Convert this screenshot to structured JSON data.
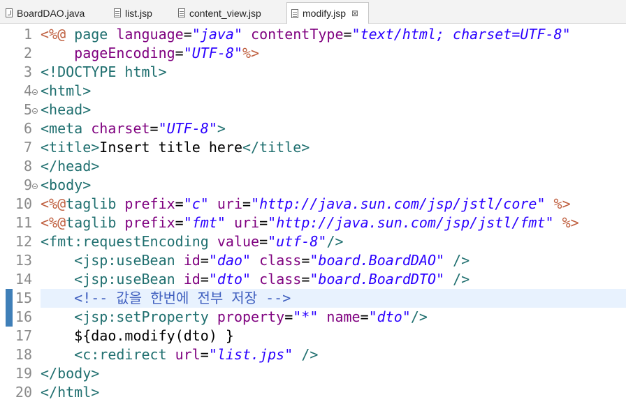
{
  "tabs": [
    {
      "label": "BoardDAO.java",
      "icon": "java-file-icon",
      "active": false
    },
    {
      "label": "list.jsp",
      "icon": "jsp-file-icon",
      "active": false
    },
    {
      "label": "content_view.jsp",
      "icon": "jsp-file-icon",
      "active": false
    },
    {
      "label": "modify.jsp",
      "icon": "jsp-file-icon",
      "active": true,
      "close": "⊠"
    }
  ],
  "colors": {
    "directive": "#bf5f3f",
    "tag": "#1f6f6f",
    "attribute": "#7f007f",
    "value": "#2a00ff",
    "comment": "#3f5fbf",
    "current_line": "#e8f2fe"
  },
  "editor": {
    "current_line": 15,
    "lines": [
      {
        "n": "1",
        "tokens": [
          {
            "t": "<%@",
            "c": "dir"
          },
          {
            "t": " page ",
            "c": "tag"
          },
          {
            "t": "language",
            "c": "attr"
          },
          {
            "t": "=",
            "c": "txt"
          },
          {
            "t": "\"java\"",
            "c": "val"
          },
          {
            "t": " ",
            "c": "txt"
          },
          {
            "t": "contentType",
            "c": "attr"
          },
          {
            "t": "=",
            "c": "txt"
          },
          {
            "t": "\"text/html; charset=UTF-8\"",
            "c": "val"
          }
        ]
      },
      {
        "n": "2",
        "tokens": [
          {
            "t": "    ",
            "c": "txt"
          },
          {
            "t": "pageEncoding",
            "c": "attr"
          },
          {
            "t": "=",
            "c": "txt"
          },
          {
            "t": "\"UTF-8\"",
            "c": "val"
          },
          {
            "t": "%>",
            "c": "dir"
          }
        ]
      },
      {
        "n": "3",
        "tokens": [
          {
            "t": "<!DOCTYPE ",
            "c": "tag"
          },
          {
            "t": "html",
            "c": "tag"
          },
          {
            "t": ">",
            "c": "tag"
          }
        ]
      },
      {
        "n": "4",
        "fold": true,
        "tokens": [
          {
            "t": "<html>",
            "c": "tag"
          }
        ]
      },
      {
        "n": "5",
        "fold": true,
        "tokens": [
          {
            "t": "<head>",
            "c": "tag"
          }
        ]
      },
      {
        "n": "6",
        "tokens": [
          {
            "t": "<meta ",
            "c": "tag"
          },
          {
            "t": "charset",
            "c": "attr"
          },
          {
            "t": "=",
            "c": "txt"
          },
          {
            "t": "\"UTF-8\"",
            "c": "val"
          },
          {
            "t": ">",
            "c": "tag"
          }
        ]
      },
      {
        "n": "7",
        "tokens": [
          {
            "t": "<title>",
            "c": "tag"
          },
          {
            "t": "Insert title here",
            "c": "txt"
          },
          {
            "t": "</title>",
            "c": "tag"
          }
        ]
      },
      {
        "n": "8",
        "tokens": [
          {
            "t": "</head>",
            "c": "tag"
          }
        ]
      },
      {
        "n": "9",
        "fold": true,
        "tokens": [
          {
            "t": "<body>",
            "c": "tag"
          }
        ]
      },
      {
        "n": "10",
        "tokens": [
          {
            "t": "<%@",
            "c": "dir"
          },
          {
            "t": "taglib ",
            "c": "tag"
          },
          {
            "t": "prefix",
            "c": "attr"
          },
          {
            "t": "=",
            "c": "txt"
          },
          {
            "t": "\"c\"",
            "c": "val"
          },
          {
            "t": " ",
            "c": "txt"
          },
          {
            "t": "uri",
            "c": "attr"
          },
          {
            "t": "=",
            "c": "txt"
          },
          {
            "t": "\"http://java.sun.com/jsp/jstl/core\"",
            "c": "val"
          },
          {
            "t": " ",
            "c": "txt"
          },
          {
            "t": "%>",
            "c": "dir"
          }
        ]
      },
      {
        "n": "11",
        "tokens": [
          {
            "t": "<%@",
            "c": "dir"
          },
          {
            "t": "taglib ",
            "c": "tag"
          },
          {
            "t": "prefix",
            "c": "attr"
          },
          {
            "t": "=",
            "c": "txt"
          },
          {
            "t": "\"fmt\"",
            "c": "val"
          },
          {
            "t": " ",
            "c": "txt"
          },
          {
            "t": "uri",
            "c": "attr"
          },
          {
            "t": "=",
            "c": "txt"
          },
          {
            "t": "\"http://java.sun.com/jsp/jstl/fmt\"",
            "c": "val"
          },
          {
            "t": " ",
            "c": "txt"
          },
          {
            "t": "%>",
            "c": "dir"
          }
        ]
      },
      {
        "n": "12",
        "tokens": [
          {
            "t": "<fmt:requestEncoding ",
            "c": "tag"
          },
          {
            "t": "value",
            "c": "attr"
          },
          {
            "t": "=",
            "c": "txt"
          },
          {
            "t": "\"utf-8\"",
            "c": "val"
          },
          {
            "t": "/>",
            "c": "tag"
          }
        ]
      },
      {
        "n": "13",
        "tokens": [
          {
            "t": "    ",
            "c": "txt"
          },
          {
            "t": "<jsp:useBean ",
            "c": "tag"
          },
          {
            "t": "id",
            "c": "attr"
          },
          {
            "t": "=",
            "c": "txt"
          },
          {
            "t": "\"dao\"",
            "c": "val"
          },
          {
            "t": " ",
            "c": "txt"
          },
          {
            "t": "class",
            "c": "attr"
          },
          {
            "t": "=",
            "c": "txt"
          },
          {
            "t": "\"board.BoardDAO\"",
            "c": "val"
          },
          {
            "t": " ",
            "c": "txt"
          },
          {
            "t": "/>",
            "c": "tag"
          }
        ]
      },
      {
        "n": "14",
        "tokens": [
          {
            "t": "    ",
            "c": "txt"
          },
          {
            "t": "<jsp:useBean ",
            "c": "tag"
          },
          {
            "t": "id",
            "c": "attr"
          },
          {
            "t": "=",
            "c": "txt"
          },
          {
            "t": "\"dto\"",
            "c": "val"
          },
          {
            "t": " ",
            "c": "txt"
          },
          {
            "t": "class",
            "c": "attr"
          },
          {
            "t": "=",
            "c": "txt"
          },
          {
            "t": "\"board.BoardDTO\"",
            "c": "val"
          },
          {
            "t": " ",
            "c": "txt"
          },
          {
            "t": "/>",
            "c": "tag"
          }
        ]
      },
      {
        "n": "15",
        "tokens": [
          {
            "t": "    ",
            "c": "txt"
          },
          {
            "t": "<!-- 값을 한번에 전부 저장 -->",
            "c": "com"
          }
        ]
      },
      {
        "n": "16",
        "tokens": [
          {
            "t": "    ",
            "c": "txt"
          },
          {
            "t": "<jsp:setProperty ",
            "c": "tag"
          },
          {
            "t": "property",
            "c": "attr"
          },
          {
            "t": "=",
            "c": "txt"
          },
          {
            "t": "\"*\"",
            "c": "val"
          },
          {
            "t": " ",
            "c": "txt"
          },
          {
            "t": "name",
            "c": "attr"
          },
          {
            "t": "=",
            "c": "txt"
          },
          {
            "t": "\"dto\"",
            "c": "val"
          },
          {
            "t": "/>",
            "c": "tag"
          }
        ]
      },
      {
        "n": "17",
        "tokens": [
          {
            "t": "    ${dao.modify(dto) }",
            "c": "txt"
          }
        ]
      },
      {
        "n": "18",
        "tokens": [
          {
            "t": "    ",
            "c": "txt"
          },
          {
            "t": "<c:redirect ",
            "c": "tag"
          },
          {
            "t": "url",
            "c": "attr"
          },
          {
            "t": "=",
            "c": "txt"
          },
          {
            "t": "\"list.jps\"",
            "c": "val"
          },
          {
            "t": " ",
            "c": "txt"
          },
          {
            "t": "/>",
            "c": "tag"
          }
        ]
      },
      {
        "n": "19",
        "tokens": [
          {
            "t": "</body>",
            "c": "tag"
          }
        ]
      },
      {
        "n": "20",
        "tokens": [
          {
            "t": "</html>",
            "c": "tag"
          }
        ]
      }
    ]
  }
}
